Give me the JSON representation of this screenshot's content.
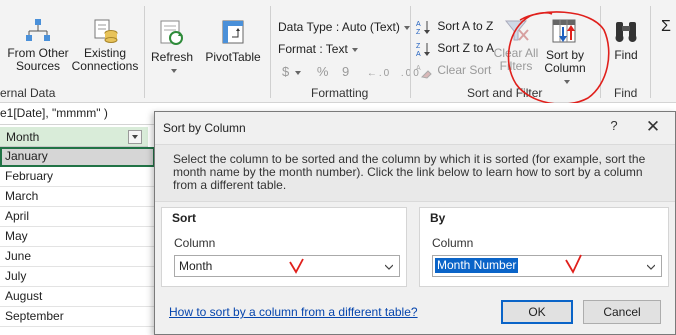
{
  "ribbon": {
    "from_other_sources": "From Other Sources",
    "existing_connections": "Existing Connections",
    "external_data_label": "ernal Data",
    "refresh": "Refresh",
    "pivottable": "PivotTable",
    "data_type": "Data Type : Auto (Text)",
    "format": "Format : Text",
    "format_symbols": [
      "$",
      "%",
      "9",
      ",",
      "←.0",
      ".00"
    ],
    "formatting_label": "Formatting",
    "sort_a_to_z": "Sort A to Z",
    "sort_z_to_a": "Sort Z to A",
    "clear_sort": "Clear Sort",
    "clear_all_filters": "Clear All Filters",
    "sort_by_column": "Sort by Column",
    "sort_filter_label": "Sort and Filter",
    "find": "Find",
    "find_label": "Find",
    "sigma": "Σ"
  },
  "formula_bar": {
    "text": "e1[Date], \"mmmm\" )"
  },
  "sheet": {
    "column_header": "Month",
    "rows": [
      "January",
      "February",
      "March",
      "April",
      "May",
      "June",
      "July",
      "August",
      "September"
    ],
    "selected_row": "January"
  },
  "dialog": {
    "title": "Sort by Column",
    "help": "?",
    "close": "✕",
    "description": "Select the column to be sorted and the column by which it is sorted (for example, sort the month name by the month number). Click the link below to learn how to sort by a column from a different table.",
    "sort_panel": {
      "title": "Sort",
      "caption": "Column",
      "value": "Month"
    },
    "by_panel": {
      "title": "By",
      "caption": "Column",
      "value": "Month Number"
    },
    "link": "How to sort by a column from a different table?",
    "ok": "OK",
    "cancel": "Cancel"
  },
  "colors": {
    "accent": "#217346",
    "annotation_red": "#e0201c",
    "link": "#0645ad",
    "selection_blue": "#0a64c8"
  }
}
